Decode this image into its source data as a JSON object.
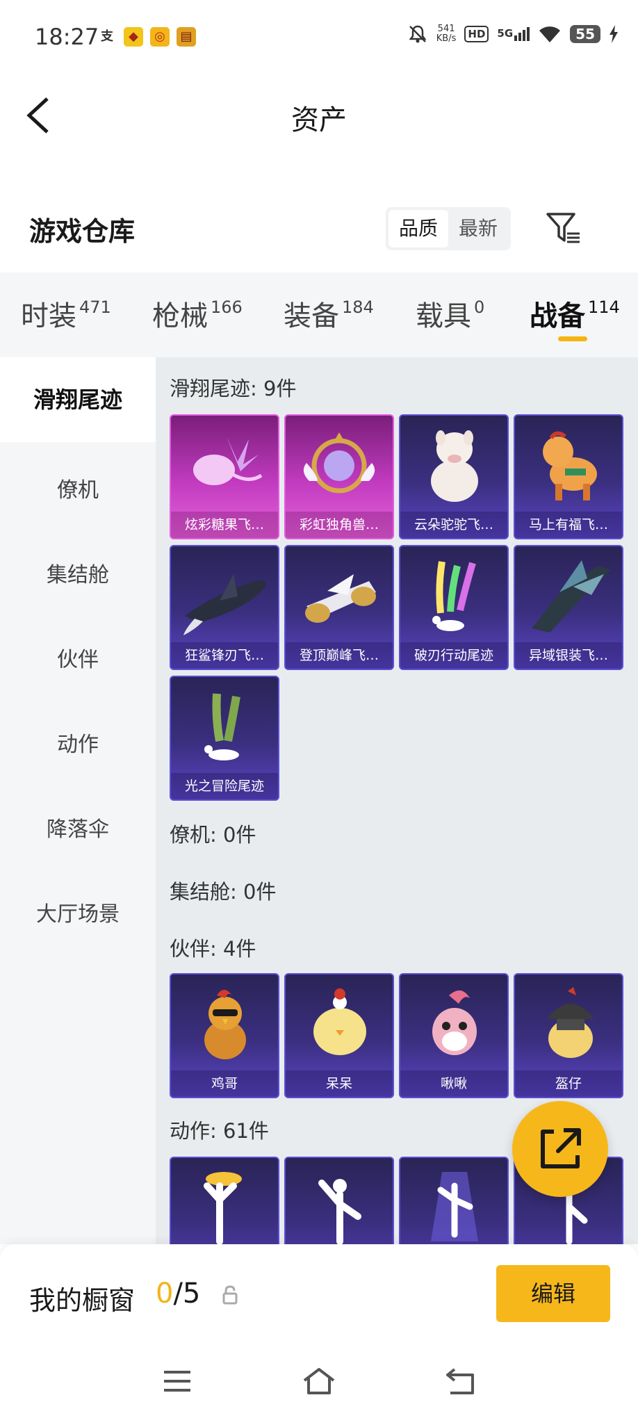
{
  "status_bar": {
    "time": "18:27",
    "net_speed_value": "541",
    "net_speed_unit": "KB/s",
    "hd_label": "HD",
    "network_label": "5G",
    "battery_level": "55"
  },
  "nav": {
    "title": "资产"
  },
  "warehouse": {
    "title": "游戏仓库",
    "sort_options": [
      "品质",
      "最新"
    ],
    "sort_selected": "品质"
  },
  "tabs": [
    {
      "label": "时装",
      "count": "471"
    },
    {
      "label": "枪械",
      "count": "166"
    },
    {
      "label": "装备",
      "count": "184"
    },
    {
      "label": "载具",
      "count": "0"
    },
    {
      "label": "战备",
      "count": "114"
    }
  ],
  "active_tab": "战备",
  "sidebar": {
    "items": [
      "滑翔尾迹",
      "僚机",
      "集结舱",
      "伙伴",
      "动作",
      "降落伞",
      "大厅场景"
    ],
    "active": "滑翔尾迹"
  },
  "sections": {
    "trails": {
      "header": "滑翔尾迹: 9件",
      "items": [
        "炫彩糖果飞…",
        "彩虹独角兽…",
        "云朵驼驼飞…",
        "马上有福飞…",
        "狂鲨锋刃飞…",
        "登顶巅峰飞…",
        "破刃行动尾迹",
        "异域银装飞…",
        "光之冒险尾迹"
      ]
    },
    "wingman": {
      "header": "僚机: 0件"
    },
    "pod": {
      "header": "集结舱: 0件"
    },
    "partner": {
      "header": "伙伴: 4件",
      "items": [
        "鸡哥",
        "呆呆",
        "啾啾",
        "盔仔"
      ]
    },
    "emote": {
      "header": "动作: 61件"
    }
  },
  "showcase": {
    "label": "我的橱窗",
    "current": "0",
    "total": "/5",
    "edit_label": "编辑"
  },
  "colors": {
    "accent": "#f6b71b",
    "card_purple": "#3b2f80",
    "card_pink": "#c23bc0"
  },
  "icons": {
    "back": "back-arrow-icon",
    "filter": "filter-icon",
    "share": "share-icon",
    "lock": "lock-icon",
    "menu": "menu-icon",
    "home": "home-icon",
    "return": "return-icon"
  }
}
